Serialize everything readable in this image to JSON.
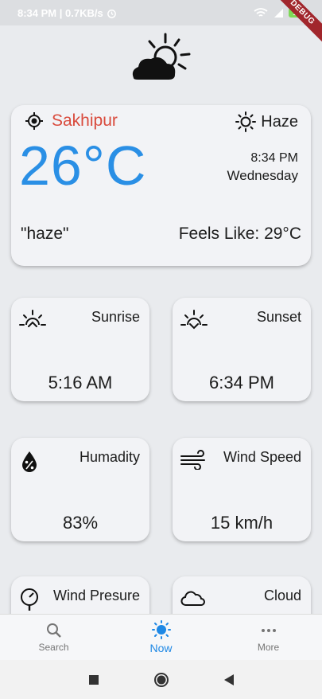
{
  "status_bar": {
    "time_speed": "8:34 PM | 0.7KB/s",
    "battery": "100",
    "debug": "DEBUG"
  },
  "main_card": {
    "location": "Sakhipur",
    "condition": "Haze",
    "temperature": "26°C",
    "time": "8:34 PM",
    "day": "Wednesday",
    "description": "\"haze\"",
    "feels_like": "Feels Like: 29°C"
  },
  "cards": {
    "sunrise": {
      "label": "Sunrise",
      "value": "5:16 AM"
    },
    "sunset": {
      "label": "Sunset",
      "value": "6:34 PM"
    },
    "humidity": {
      "label": "Humadity",
      "value": "83%"
    },
    "wind_speed": {
      "label": "Wind Speed",
      "value": "15 km/h"
    },
    "wind_pressure": {
      "label": "Wind Presure"
    },
    "cloud": {
      "label": "Cloud"
    }
  },
  "bottom_nav": [
    {
      "label": "Search",
      "icon": "search-icon"
    },
    {
      "label": "Now",
      "icon": "sun-icon"
    },
    {
      "label": "More",
      "icon": "more-icon"
    }
  ],
  "colors": {
    "accent": "#2a8fe5",
    "location": "#d94a3c",
    "nav_active": "#1e88e5"
  }
}
